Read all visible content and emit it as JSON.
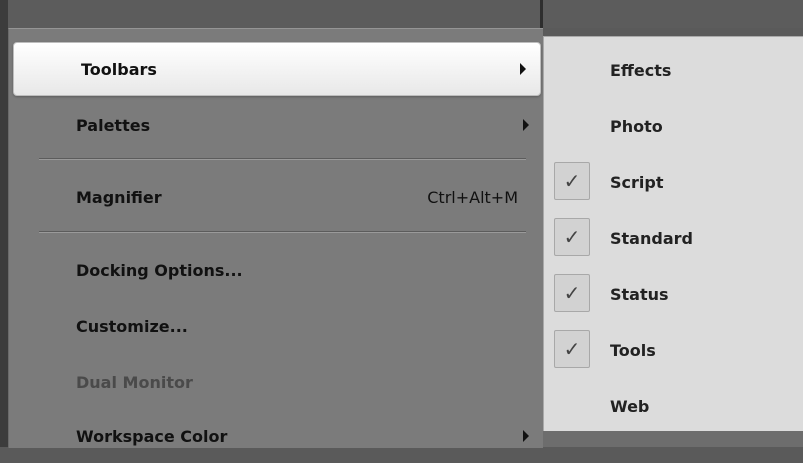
{
  "main_menu": {
    "items": [
      {
        "label": "Toolbars",
        "shortcut": "",
        "submenu": true,
        "highlighted": true,
        "disabled": false
      },
      {
        "label": "Palettes",
        "shortcut": "",
        "submenu": true,
        "highlighted": false,
        "disabled": false
      },
      {
        "label": "Magnifier",
        "shortcut": "Ctrl+Alt+M",
        "submenu": false,
        "highlighted": false,
        "disabled": false
      },
      {
        "label": "Docking Options...",
        "shortcut": "",
        "submenu": false,
        "highlighted": false,
        "disabled": false
      },
      {
        "label": "Customize...",
        "shortcut": "",
        "submenu": false,
        "highlighted": false,
        "disabled": false
      },
      {
        "label": "Dual Monitor",
        "shortcut": "",
        "submenu": false,
        "highlighted": false,
        "disabled": true
      },
      {
        "label": "Workspace Color",
        "shortcut": "",
        "submenu": true,
        "highlighted": false,
        "disabled": false
      }
    ]
  },
  "toolbars_submenu": {
    "items": [
      {
        "label": "Effects",
        "checked": false
      },
      {
        "label": "Photo",
        "checked": false
      },
      {
        "label": "Script",
        "checked": true
      },
      {
        "label": "Standard",
        "checked": true
      },
      {
        "label": "Status",
        "checked": true
      },
      {
        "label": "Tools",
        "checked": true
      },
      {
        "label": "Web",
        "checked": false
      }
    ],
    "check_glyph": "✓"
  },
  "colors": {
    "menu_bg": "#7b7b7b",
    "submenu_bg": "#dcdcdc",
    "highlight_bg": "#ffffff",
    "disabled_text": "#4a4a4a"
  }
}
